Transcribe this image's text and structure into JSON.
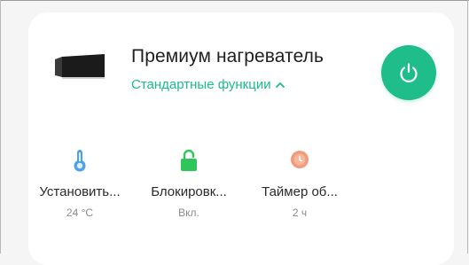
{
  "device": {
    "name": "Премиум нагреватель",
    "features_link": "Стандартные функции"
  },
  "icons": {
    "power": "power-icon",
    "expand": "chevron-up-icon"
  },
  "colors": {
    "accent": "#1ebd8a",
    "thermometer": "#4aa3e8",
    "lock": "#2ec65a",
    "timer": "#f29a7c"
  },
  "functions": [
    {
      "label": "Установить...",
      "value": "24 °C",
      "icon": "thermometer-icon"
    },
    {
      "label": "Блокировк...",
      "value": "Вкл.",
      "icon": "lock-icon"
    },
    {
      "label": "Таймер об...",
      "value": "2 ч",
      "icon": "timer-icon"
    }
  ]
}
